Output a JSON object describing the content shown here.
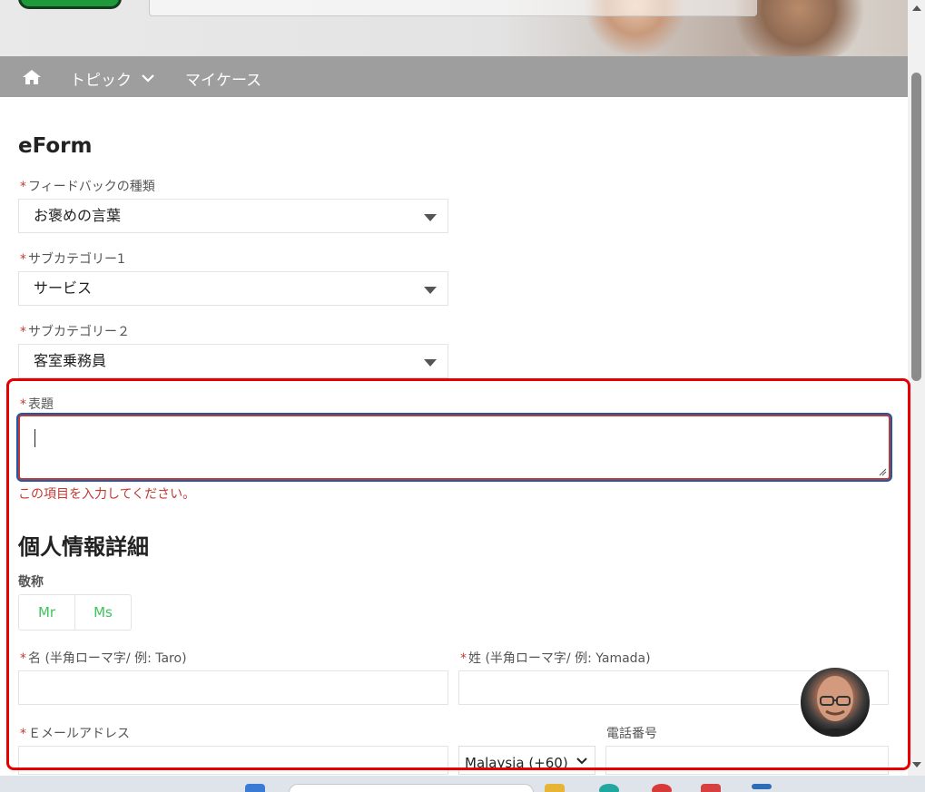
{
  "header": {
    "search_placeholder": "",
    "brand_colors": {
      "logo_green": "#1f9a3b",
      "nav_bg": "#9e9e9e"
    }
  },
  "nav": {
    "items": [
      {
        "label": "トピック",
        "has_dropdown": true
      },
      {
        "label": "マイケース"
      }
    ],
    "home_icon": "home-icon"
  },
  "form": {
    "title": "eForm",
    "required_mark": "*",
    "feedback_type": {
      "label": "フィードバックの種類",
      "value": "お褒めの言葉"
    },
    "subcategory1": {
      "label": "サブカテゴリー1",
      "value": "サービス"
    },
    "subcategory2": {
      "label": "サブカテゴリー２",
      "value": "客室乗務員"
    },
    "subject": {
      "label": "表題",
      "value": "",
      "error": "この項目を入力してください。"
    },
    "personal_section": {
      "title": "個人情報詳細",
      "salutation": {
        "label": "敬称",
        "options": [
          "Mr",
          "Ms"
        ]
      },
      "first_name": {
        "label": "名 (半角ローマ字/ 例: Taro)"
      },
      "last_name": {
        "label": "姓 (半角ローマ字/ 例: Yamada)"
      },
      "email": {
        "label": "Ｅメールアドレス"
      },
      "country_code": {
        "value": "Malaysia (+60)"
      },
      "phone": {
        "label": "電話番号"
      }
    }
  },
  "colors": {
    "error": "#c23934",
    "focus": "#1b5aa8",
    "toggle_text": "#3ec45a",
    "highlight": "#e60000"
  }
}
